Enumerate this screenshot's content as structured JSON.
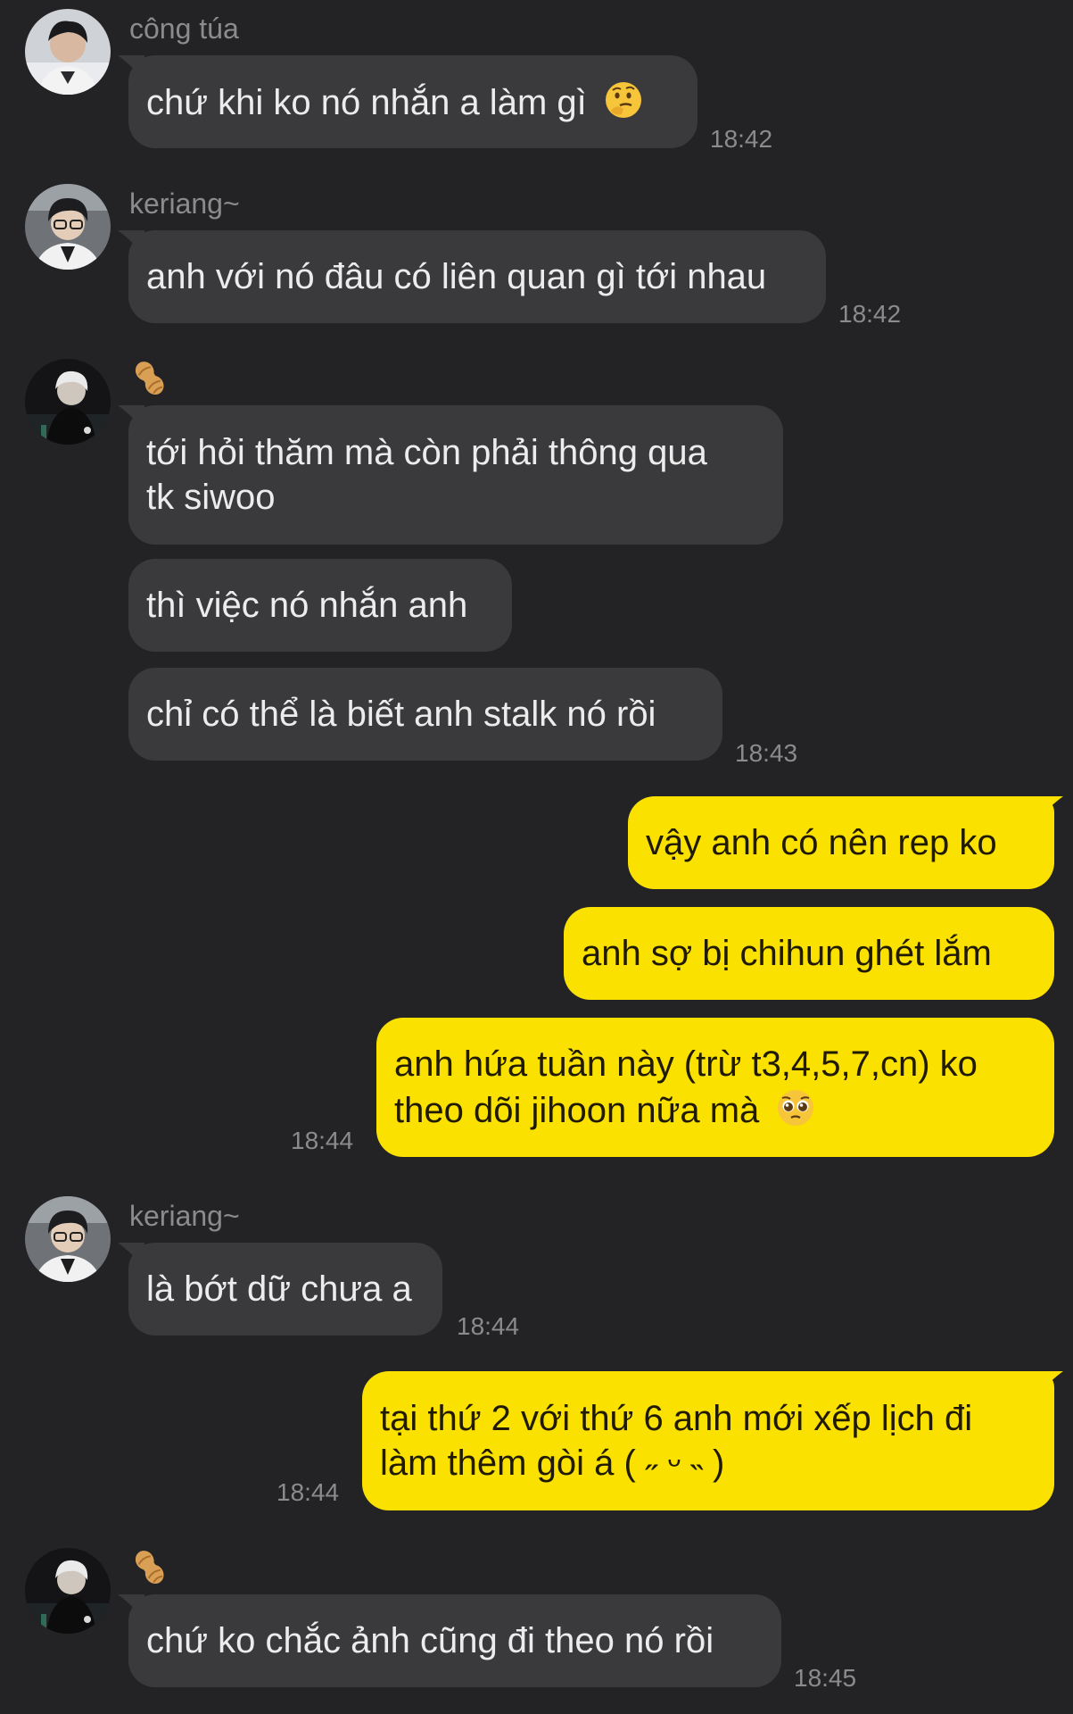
{
  "messages": [
    {
      "sender": "công túa",
      "text": "chứ khi ko nó nhắn a làm gì",
      "emoji": "thinking-face-emoji",
      "time": "18:42"
    },
    {
      "sender": "keriang~",
      "text": "anh với nó đâu có liên quan gì tới nhau",
      "time": "18:42"
    },
    {
      "sender_icon": "peanut-icon",
      "lines": [
        "tới hỏi thăm mà còn phải thông qua",
        "tk siwoo"
      ]
    },
    {
      "text": "thì việc nó nhắn anh"
    },
    {
      "text": "chỉ có thể là biết anh stalk nó rồi",
      "time": "18:43"
    },
    {
      "text": "vậy anh có nên rep ko",
      "outgoing": true
    },
    {
      "text": "anh sợ bị chihun ghét lắm",
      "outgoing": true
    },
    {
      "lines": [
        "anh hứa tuần này (trừ t3,4,5,7,cn) ko",
        "theo dõi jihoon nữa mà"
      ],
      "emoji": "pleading-face-emoji",
      "time": "18:44",
      "outgoing": true
    },
    {
      "sender": "keriang~",
      "text": "là bớt dữ chưa a",
      "time": "18:44"
    },
    {
      "lines": [
        "tại thứ 2 với thứ 6 anh mới xếp lịch đi",
        "làm thêm gòi á ( ˶ ᵕ ˵ )"
      ],
      "time": "18:44",
      "outgoing": true
    },
    {
      "sender_icon": "peanut-icon",
      "text": "chứ ko chắc ảnh cũng đi theo nó rồi",
      "time": "18:45"
    }
  ],
  "colors": {
    "background": "#232325",
    "incoming_bubble": "#3a3a3d",
    "outgoing_bubble": "#fae100",
    "meta_text": "#8b8b8d"
  }
}
